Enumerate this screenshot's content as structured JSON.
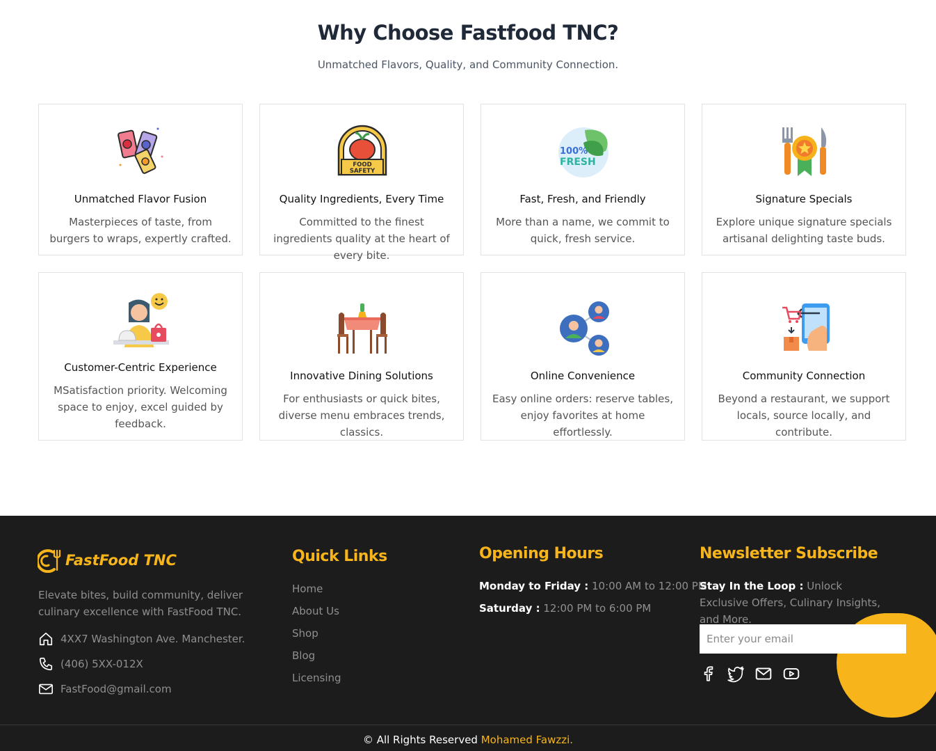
{
  "why": {
    "title": "Why Choose Fastfood TNC?",
    "subtitle": "Unmatched Flavors, Quality, and Community Connection."
  },
  "cards": [
    {
      "title": "Unmatched Flavor Fusion",
      "desc": "Masterpieces of taste, from burgers to wraps, expertly crafted.",
      "icon": "snack-packs-icon"
    },
    {
      "title": "Quality Ingredients, Every Time",
      "desc": "Committed to the finest ingredients quality at the heart of every bite.",
      "icon": "food-safety-icon",
      "icon_text": "FOOD SAFETY"
    },
    {
      "title": "Fast, Fresh, and Friendly",
      "desc": "More than a name, we commit to quick, fresh service.",
      "icon": "fresh-badge-icon",
      "icon_text": "100% FRESH"
    },
    {
      "title": "Signature Specials",
      "desc": "Explore unique signature specials artisanal delighting taste buds.",
      "icon": "award-cutlery-icon"
    },
    {
      "title": "Customer-Centric Experience",
      "desc": "MSatisfaction priority. Welcoming space to enjoy, excel guided by feedback.",
      "icon": "customer-service-icon"
    },
    {
      "title": "Innovative Dining Solutions",
      "desc": "For enthusiasts or quick bites, diverse menu embraces trends, classics.",
      "icon": "dining-table-icon"
    },
    {
      "title": "Online Convenience",
      "desc": "Easy online orders: reserve tables, enjoy favorites at home effortlessly.",
      "icon": "network-users-icon"
    },
    {
      "title": "Community Connection",
      "desc": "Beyond a restaurant, we support locals, source locally, and contribute.",
      "icon": "mobile-order-icon"
    }
  ],
  "footer": {
    "brand": "FastFood TNC",
    "description": "Elevate bites, build community, deliver culinary excellence with FastFood TNC.",
    "address": "4XX7 Washington Ave. Manchester.",
    "phone": "(406) 5XX-012X",
    "email": "FastFood@gmail.com",
    "quick_links_title": "Quick Links",
    "quick_links": [
      "Home",
      "About Us",
      "Shop",
      "Blog",
      "Licensing"
    ],
    "hours_title": "Opening Hours",
    "hours": [
      {
        "days": "Monday to Friday :",
        "time": "10:00 AM to 12:00 PM"
      },
      {
        "days": "Saturday :",
        "time": "12:00 PM to 6:00 PM"
      }
    ],
    "newsletter_title": "Newsletter Subscribe",
    "newsletter_lead": "Stay In the Loop :",
    "newsletter_text": "Unlock Exclusive Offers, Culinary Insights, and More.",
    "email_placeholder": "Enter your email",
    "social": [
      "facebook-icon",
      "twitter-icon",
      "mail-icon",
      "youtube-icon"
    ],
    "copyright_prefix": "© All Rights Reserved",
    "copyright_name": "Mohamed Fawzzi."
  },
  "colors": {
    "accent": "#f7b51b",
    "footer_bg": "#1c1c1c"
  }
}
